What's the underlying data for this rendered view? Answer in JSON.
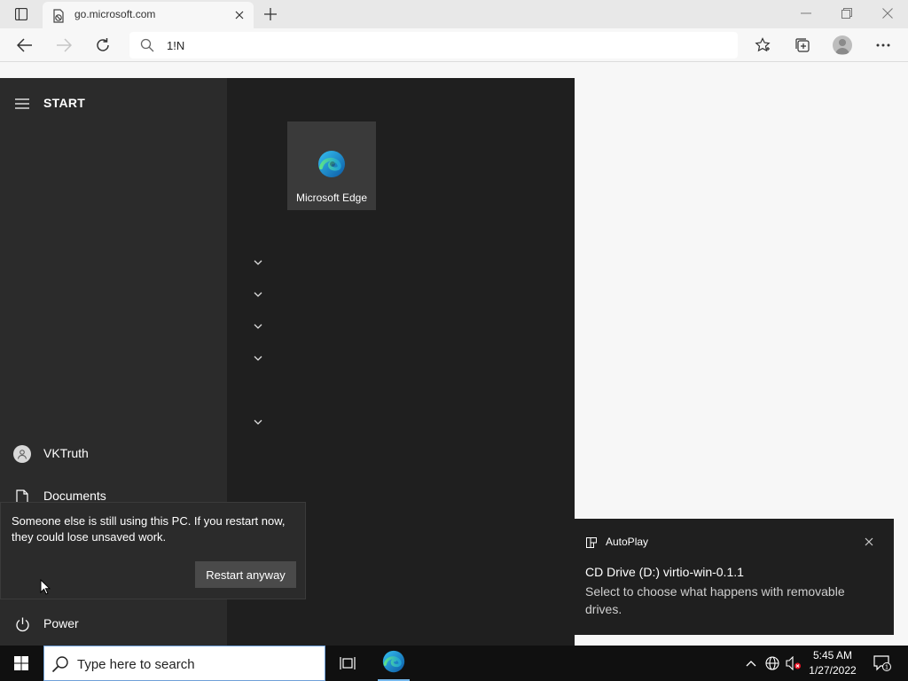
{
  "browser": {
    "tab_title": "go.microsoft.com",
    "address_value": "1!N"
  },
  "start_menu": {
    "title": "START",
    "user_name": "VKTruth",
    "documents_label": "Documents",
    "power_label": "Power",
    "tiles": [
      {
        "label": "Microsoft Edge"
      }
    ]
  },
  "restart_flyout": {
    "message": "Someone else is still using this PC. If you restart now, they could lose unsaved work.",
    "button_label": "Restart anyway"
  },
  "toast": {
    "app_name": "AutoPlay",
    "title": "CD Drive (D:) virtio-win-0.1.1",
    "body": "Select to choose what happens with removable drives."
  },
  "taskbar": {
    "search_placeholder": "Type here to search",
    "time": "5:45 AM",
    "date": "1/27/2022",
    "notification_count": "1"
  },
  "icons": [
    "tab-actions-icon",
    "page-favicon",
    "close-icon",
    "plus-icon",
    "minimize-icon",
    "restore-icon",
    "back-icon",
    "forward-icon",
    "refresh-icon",
    "search-icon",
    "favorites-icon",
    "collections-icon",
    "profile-icon",
    "more-icon",
    "hamburger-icon",
    "user-icon",
    "document-icon",
    "power-icon",
    "edge-icon",
    "chevron-down-icon",
    "autoplay-icon",
    "windows-logo-icon",
    "task-view-icon",
    "chevron-up-icon",
    "network-icon",
    "volume-muted-icon",
    "notification-icon"
  ],
  "colors": {
    "start_left_bg": "#2b2b2b",
    "start_right_bg": "#1f1f1f",
    "taskbar_bg": "#101010",
    "accent": "#0078d4"
  }
}
